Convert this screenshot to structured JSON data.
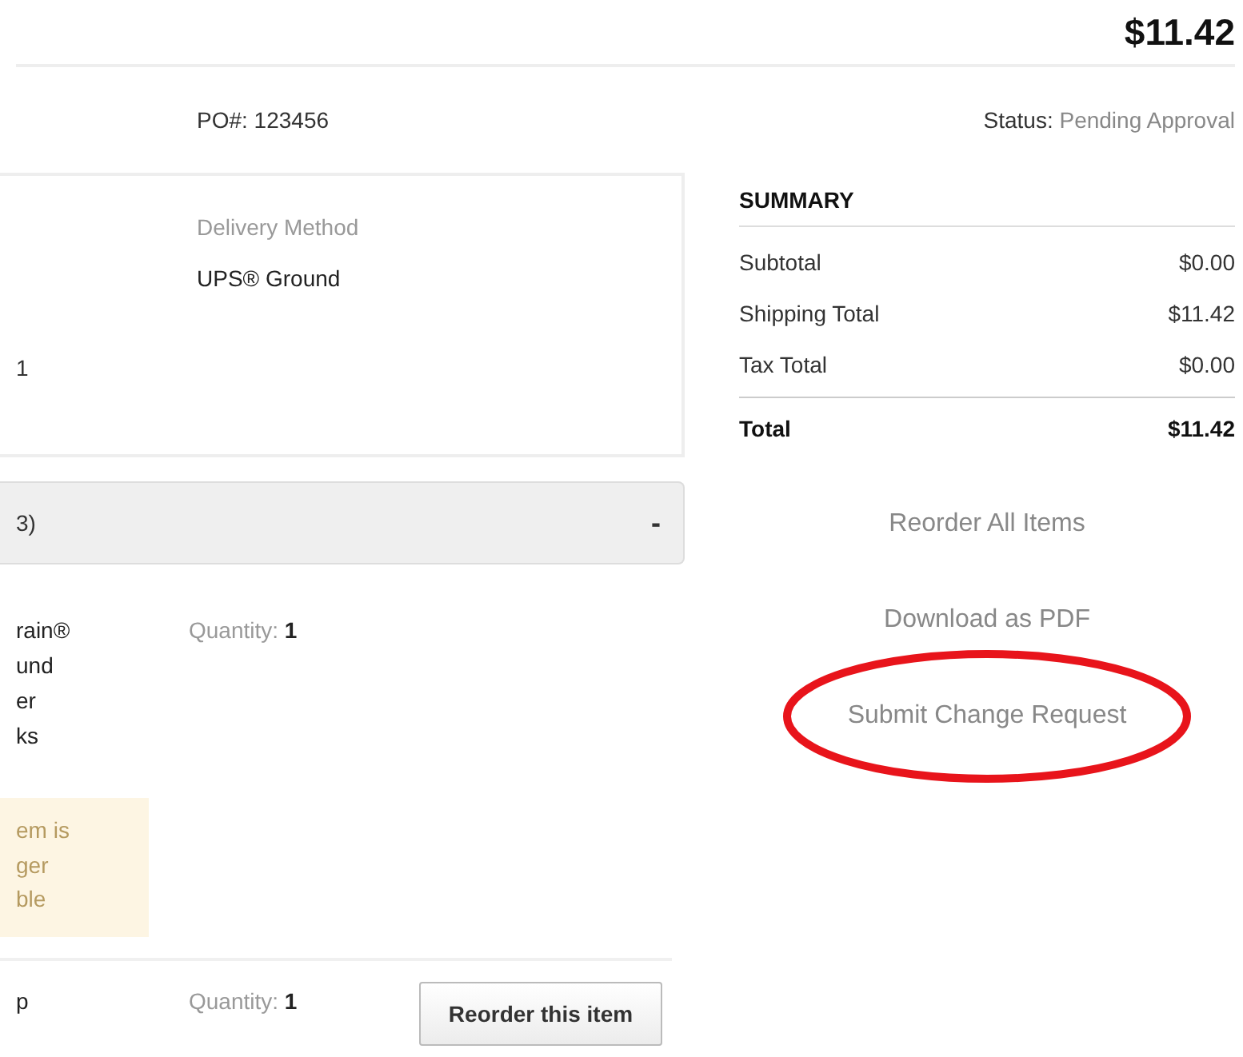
{
  "total": "$11.42",
  "po": {
    "label": "PO#:",
    "value": "123456"
  },
  "status": {
    "label": "Status:",
    "value": "Pending Approval"
  },
  "shipping": {
    "left_fragment": "1",
    "delivery_label": "Delivery Method",
    "delivery_value": "UPS® Ground"
  },
  "items_section": {
    "title_fragment": "3)",
    "toggle": "-"
  },
  "items": [
    {
      "name_lines": [
        "rain®",
        "und",
        "er",
        "ks"
      ],
      "quantity_label": "Quantity:",
      "quantity": "1",
      "notice_lines": [
        "em is",
        "ger",
        "ble"
      ]
    },
    {
      "name_lines": [
        "p"
      ],
      "quantity_label": "Quantity:",
      "quantity": "1",
      "button": "Reorder this item"
    }
  ],
  "summary": {
    "title": "SUMMARY",
    "rows": [
      {
        "label": "Subtotal",
        "value": "$0.00",
        "kind": "line"
      },
      {
        "label": "Shipping Total",
        "value": "$11.42",
        "kind": "line"
      },
      {
        "label": "Tax Total",
        "value": "$0.00",
        "kind": "line"
      },
      {
        "label": "Total",
        "value": "$11.42",
        "kind": "total"
      }
    ]
  },
  "actions": [
    {
      "label": "Reorder All Items",
      "highlighted": false
    },
    {
      "label": "Download as PDF",
      "highlighted": false
    },
    {
      "label": "Submit Change Request",
      "highlighted": true
    }
  ]
}
